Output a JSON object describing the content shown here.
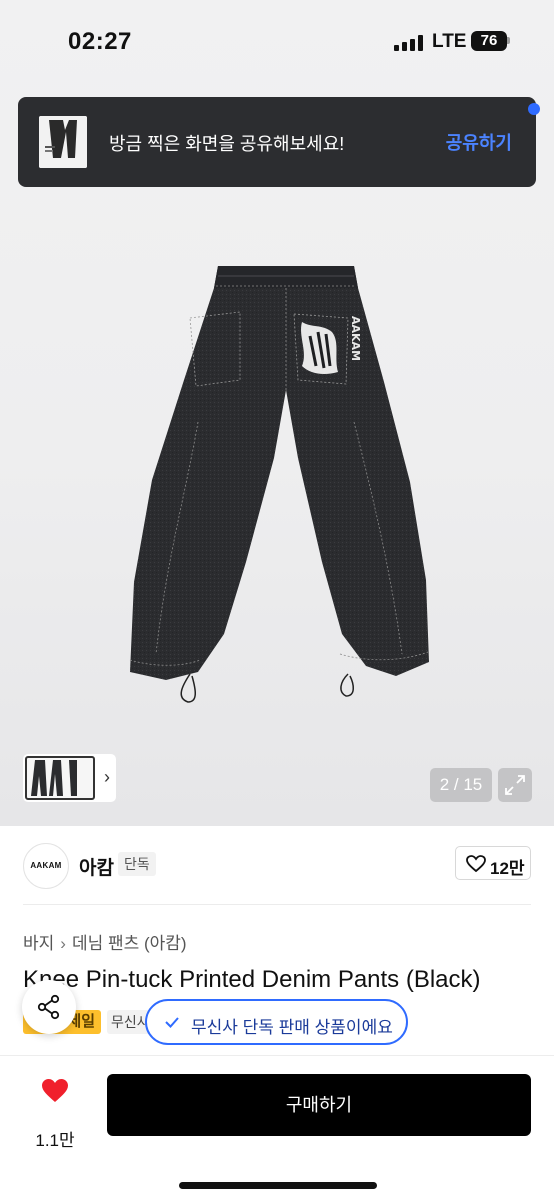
{
  "status_bar": {
    "time": "02:27",
    "network": "LTE",
    "battery": "76"
  },
  "toast": {
    "message": "방금 찍은 화면을 공유해보세요!",
    "action": "공유하기"
  },
  "gallery": {
    "counter": "2 / 15",
    "current": 2,
    "total": 15
  },
  "brand": {
    "logo_text": "AAKAM",
    "name": "아캄",
    "badge": "단독",
    "likes": "12만"
  },
  "breadcrumb": {
    "category": "바지",
    "subcategory": "데님 팬츠 (아캄)"
  },
  "product": {
    "title": "Knee Pin-tuck Printed Denim Pants (Black)"
  },
  "tags": {
    "sale": "세일",
    "musinsa": "무신사"
  },
  "exclusive_notice": "무신사 단독 판매 상품이에요",
  "bottom_bar": {
    "wish_count": "1.1만",
    "buy_label": "구매하기"
  },
  "colors": {
    "accent_blue": "#2f6bff",
    "sale_yellow": "#fdbf2c",
    "like_red": "#f0202c",
    "toast_bg": "#2c2d30"
  },
  "icons": [
    "signal-icon",
    "battery-icon",
    "chevron-right-icon",
    "expand-icon",
    "heart-outline-icon",
    "share-icon",
    "check-icon",
    "heart-filled-icon"
  ]
}
